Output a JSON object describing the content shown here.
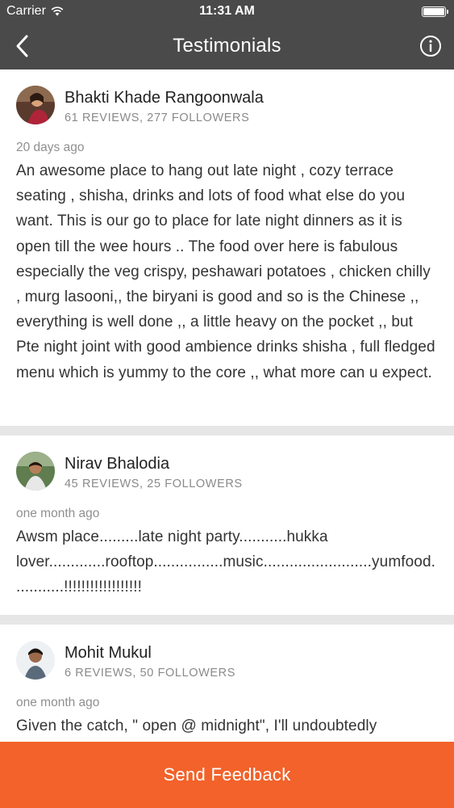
{
  "statusbar": {
    "carrier": "Carrier",
    "time": "11:31 AM"
  },
  "nav": {
    "title": "Testimonials",
    "back_icon": "chevron-left-icon",
    "info_icon": "info-icon"
  },
  "reviews": [
    {
      "name": "Bhakti Khade Rangoonwala",
      "meta": "61 REVIEWS, 277 FOLLOWERS",
      "ago": "20 days ago",
      "text": "An awesome place to hang out late night , cozy terrace seating , shisha, drinks and lots of food what else do you want. This is our go to place for late night dinners as it is open till the wee hours .. The food over here is fabulous especially the veg crispy, peshawari potatoes , chicken chilly , murg lasooni,, the biryani is good and so is the Chinese ,, everything is well done ,, a little heavy on the pocket ,, but Pte night joint with good ambience drinks shisha , full fledged menu which is yummy to the core ,, what more can u expect."
    },
    {
      "name": "Nirav Bhalodia",
      "meta": "45 REVIEWS, 25 FOLLOWERS",
      "ago": "one month ago",
      "text": "Awsm place.........late night party...........hukka lover.............rooftop................music.........................yumfood............!!!!!!!!!!!!!!!!!!"
    },
    {
      "name": "Mohit Mukul",
      "meta": "6 REVIEWS, 50 FOLLOWERS",
      "ago": "one month ago",
      "text": "Given the catch, \" open @ midnight\", I'll undoubtedly"
    }
  ],
  "footer": {
    "button_label": "Send Feedback"
  },
  "colors": {
    "header_bg": "#4a4a4a",
    "accent": "#f2622a",
    "separator": "#e6e6e6"
  }
}
